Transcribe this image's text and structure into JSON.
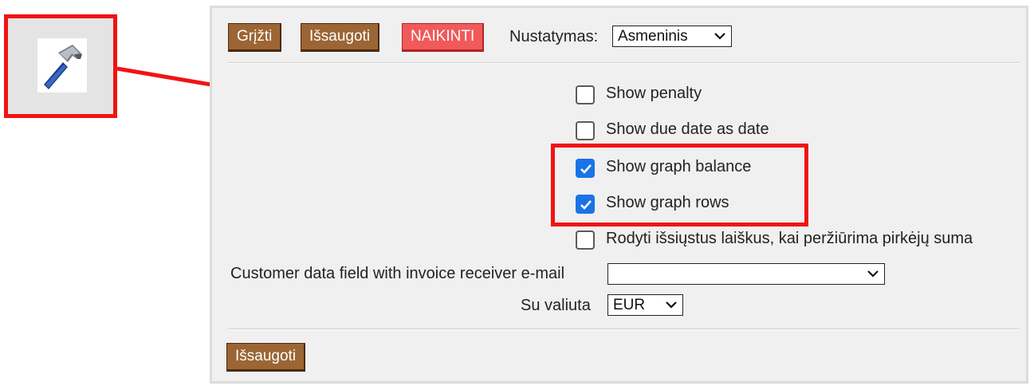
{
  "tool_icon": {
    "name": "hammer-icon"
  },
  "toolbar": {
    "back_label": "Grįžti",
    "save_label": "Išsaugoti",
    "delete_label": "NAIKINTI",
    "settings_label": "Nustatymas:",
    "settings_value": "Asmeninis"
  },
  "options": [
    {
      "label": "Show penalty",
      "checked": false
    },
    {
      "label": "Show due date as date",
      "checked": false
    },
    {
      "label": "Show graph balance",
      "checked": true
    },
    {
      "label": "Show graph rows",
      "checked": true
    },
    {
      "label": "Rodyti išsiųstus laiškus, kai peržiūrima pirkėjų suma",
      "checked": false
    }
  ],
  "email_field": {
    "label": "Customer data field with invoice receiver e-mail",
    "value": ""
  },
  "currency": {
    "label": "Su valiuta",
    "value": "EUR"
  },
  "footer": {
    "save_label": "Išsaugoti"
  },
  "colors": {
    "highlight": "#f01414",
    "button_brown": "#9c6534",
    "button_red": "#f05a5a",
    "checkbox_checked": "#1a73e8"
  }
}
